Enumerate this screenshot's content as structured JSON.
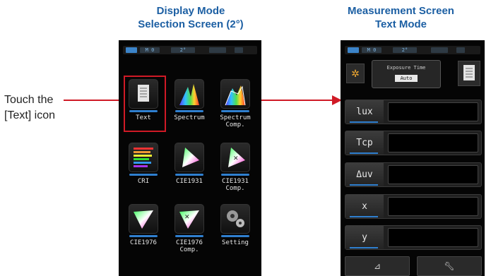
{
  "headings": {
    "left": [
      "Display Mode",
      "Selection Screen (2°)"
    ],
    "right": [
      "Measurement Screen",
      "Text Mode"
    ]
  },
  "callout": {
    "line1": "Touch the",
    "line2": "[Text] icon"
  },
  "status_bar": {
    "memory": "M 0",
    "angle": "2°"
  },
  "tiles": [
    {
      "label": "Text",
      "icon": "text-document-icon"
    },
    {
      "label": "Spectrum",
      "icon": "spectrum-icon"
    },
    {
      "label": "Spectrum\nComp.",
      "icon": "spectrum-comp-icon"
    },
    {
      "label": "CRI",
      "icon": "cri-icon"
    },
    {
      "label": "CIE1931",
      "icon": "cie1931-icon"
    },
    {
      "label": "CIE1931\nComp.",
      "icon": "cie1931-comp-icon"
    },
    {
      "label": "CIE1976",
      "icon": "cie1976-icon"
    },
    {
      "label": "CIE1976\nComp.",
      "icon": "cie1976-comp-icon"
    },
    {
      "label": "Setting",
      "icon": "setting-gear-icon"
    }
  ],
  "measurement": {
    "exposure_title": "Exposure Time",
    "exposure_value": "Auto",
    "rows": [
      "lux",
      "Tcp",
      "Δuv",
      "x",
      "y"
    ]
  },
  "colors": {
    "heading": "#1c5fa3",
    "highlight": "#d01a26",
    "accent": "#2f7fcf"
  }
}
